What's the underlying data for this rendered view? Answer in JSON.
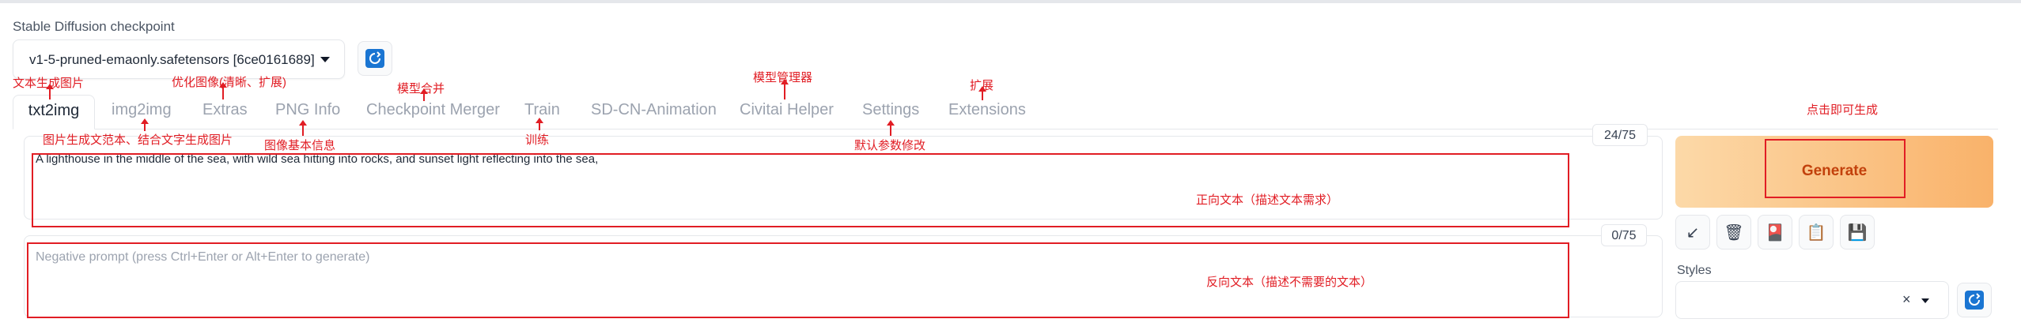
{
  "checkpoint": {
    "label": "Stable Diffusion checkpoint",
    "value": "v1-5-pruned-emaonly.safetensors [6ce0161689]"
  },
  "tabs": [
    {
      "label": "txt2img",
      "active": true
    },
    {
      "label": "img2img"
    },
    {
      "label": "Extras"
    },
    {
      "label": "PNG Info"
    },
    {
      "label": "Checkpoint Merger"
    },
    {
      "label": "Train"
    },
    {
      "label": "SD-CN-Animation"
    },
    {
      "label": "Civitai Helper"
    },
    {
      "label": "Settings"
    },
    {
      "label": "Extensions"
    }
  ],
  "prompt": {
    "value": "A lighthouse in the middle of the sea, with wild sea hitting into rocks, and sunset light reflecting into the sea,",
    "counter": "24/75"
  },
  "negative_prompt": {
    "placeholder": "Negative prompt (press Ctrl+Enter or Alt+Enter to generate)",
    "counter": "0/75"
  },
  "generate": {
    "label": "Generate"
  },
  "tools": [
    {
      "icon": "arrow-diagonal-icon",
      "glyph": "↙"
    },
    {
      "icon": "trash-icon",
      "glyph": "🗑"
    },
    {
      "icon": "red-card-icon",
      "glyph": "🎴"
    },
    {
      "icon": "clipboard-icon",
      "glyph": "📋"
    },
    {
      "icon": "save-icon",
      "glyph": "💾"
    }
  ],
  "styles": {
    "label": "Styles",
    "clear_glyph": "×"
  },
  "annotations": {
    "txt2img_top": "文本生成图片",
    "extras_top": "优化图像(清晰、扩展)",
    "ckpt_merger_top": "模型合并",
    "civitai_top": "模型管理器",
    "extensions_top": "扩展",
    "generate_top": "点击即可生成",
    "img2img_bottom": "图片生成文范本、结合文字生成图片",
    "pnginfo_bottom": "图像基本信息",
    "train_bottom": "训练",
    "settings_bottom": "默认参数修改",
    "prompt_note": "正向文本（描述文本需求）",
    "negative_note": "反向文本（描述不需要的文本）"
  },
  "colors": {
    "accent": "#1a75d2",
    "annotation": "#e11d24",
    "generate_text": "#c2410c"
  }
}
